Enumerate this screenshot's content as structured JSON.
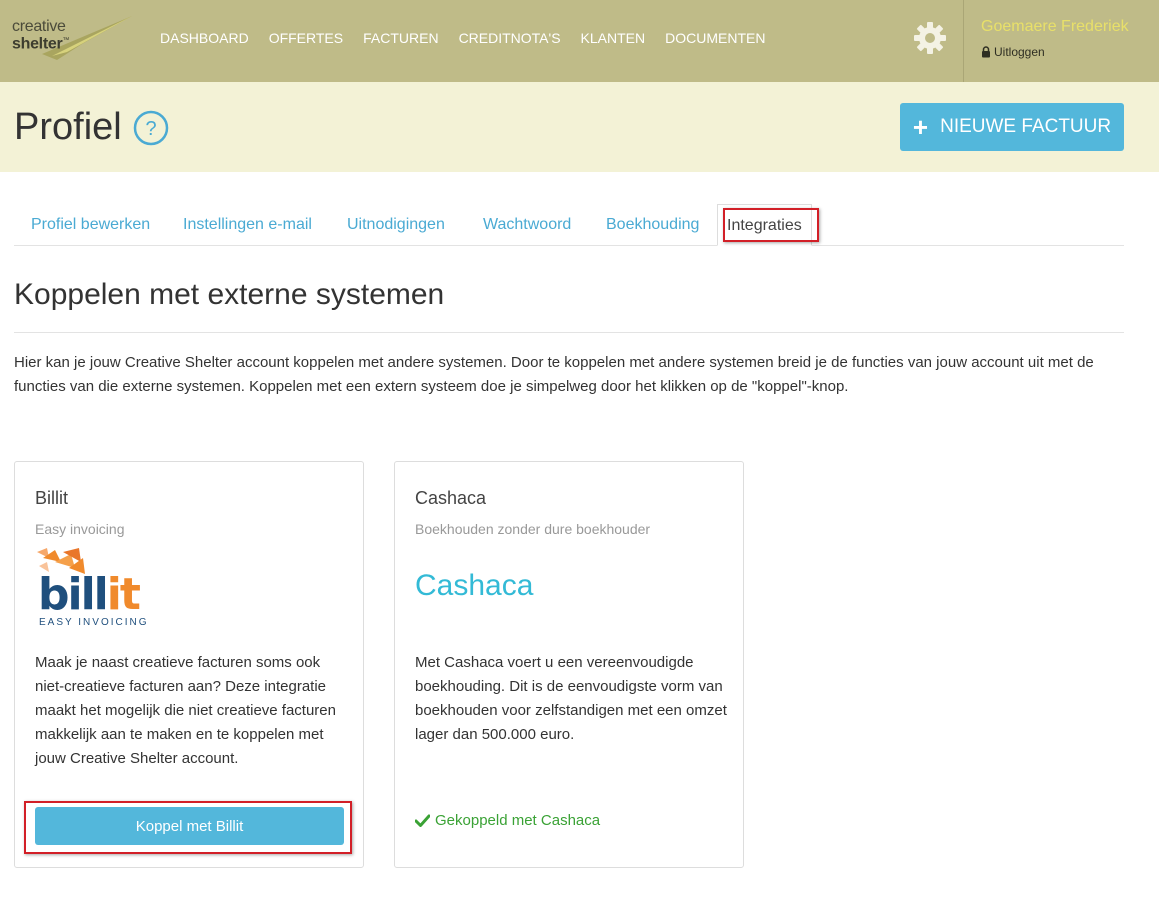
{
  "brand": {
    "logo_line1": "creative",
    "logo_line2": "shelter",
    "logo_tm": "™"
  },
  "nav": {
    "items": [
      {
        "label": "DASHBOARD"
      },
      {
        "label": "OFFERTES"
      },
      {
        "label": "FACTUREN"
      },
      {
        "label": "CREDITNOTA'S"
      },
      {
        "label": "KLANTEN"
      },
      {
        "label": "DOCUMENTEN"
      }
    ],
    "user_name": "Goemaere Frederiek",
    "logout_label": "Uitloggen"
  },
  "header": {
    "title": "Profiel",
    "new_invoice_label": "NIEUWE FACTUUR"
  },
  "tabs": [
    {
      "label": "Profiel bewerken"
    },
    {
      "label": "Instellingen e-mail"
    },
    {
      "label": "Uitnodigingen"
    },
    {
      "label": "Wachtwoord"
    },
    {
      "label": "Boekhouding"
    },
    {
      "label": "Integraties",
      "active": true
    }
  ],
  "section": {
    "title": "Koppelen met externe systemen",
    "intro": "Hier kan je jouw Creative Shelter account koppelen met andere systemen. Door te koppelen met andere systemen breid je de functies van jouw account uit met de functies van die externe systemen. Koppelen met een extern systeem doe je simpelweg door het klikken op de \"koppel\"-knop."
  },
  "integrations": [
    {
      "title": "Billit",
      "subtitle": "Easy invoicing",
      "logo_text": "billit",
      "logo_sub": "EASY INVOICING",
      "description": "Maak je naast creatieve facturen soms ook niet-creatieve facturen aan? Deze integratie maakt het mogelijk die niet creatieve facturen makkelijk aan te maken en te koppelen met jouw Creative Shelter account.",
      "button_label": "Koppel met Billit"
    },
    {
      "title": "Cashaca",
      "subtitle": "Boekhouden zonder dure boekhouder",
      "logo_text": "Cashaca",
      "description": "Met Cashaca voert u een vereenvoudigde boekhouding. Dit is de eenvoudigste vorm van boekhouden voor zelfstandigen met een omzet lager dan 500.000 euro.",
      "status_label": "Gekoppeld met Cashaca"
    }
  ],
  "colors": {
    "navbar": "#bfbb88",
    "title_band": "#f3f2d6",
    "accent_blue": "#53b7db",
    "link_blue": "#4aaad3",
    "success_green": "#3aa235",
    "highlight_red": "#d21f27",
    "user_yellow": "#e8e069"
  },
  "icons": {
    "settings": "gear-icon",
    "logout": "lock-icon",
    "help": "question-circle-icon",
    "new": "plus-icon",
    "connected": "check-icon"
  }
}
